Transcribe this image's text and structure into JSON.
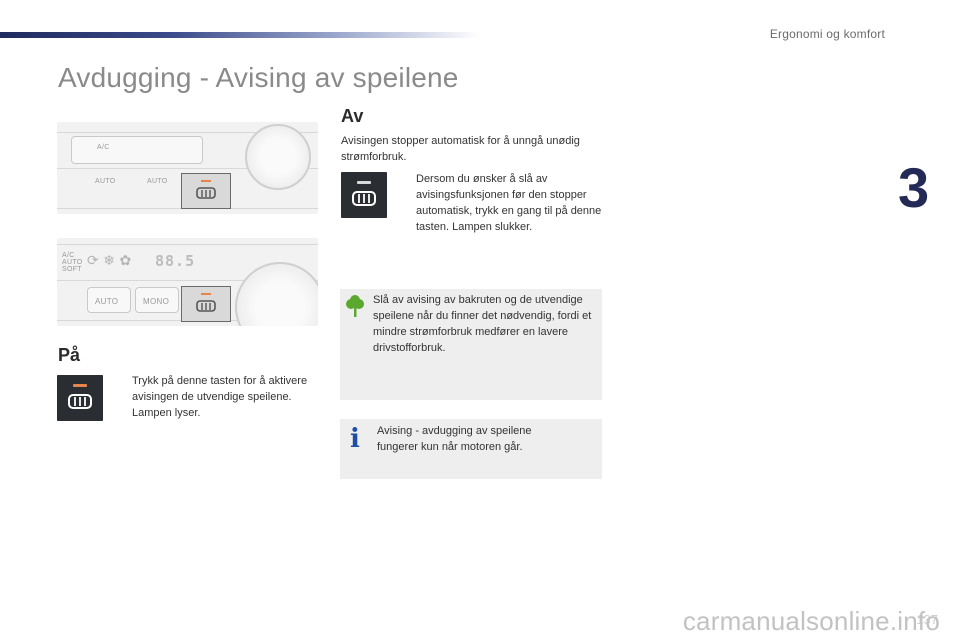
{
  "header": {
    "section_title": "Ergonomi og komfort",
    "chapter_number": "3"
  },
  "page": {
    "title": "Avdugging - Avising av speilene",
    "page_number": "137"
  },
  "illustration_top": {
    "labels": [
      "A/C",
      "AUTO",
      "AUTO"
    ],
    "highlighted_button_icon": "mirror-defrost-icon"
  },
  "illustration_bottom": {
    "labels": [
      "AUTO",
      "MONO",
      "A/C",
      "AUTO",
      "SOFT"
    ],
    "display_readout": "88.5",
    "highlighted_button_icon": "mirror-defrost-icon"
  },
  "section_on": {
    "heading": "På",
    "bullet_symbol": "",
    "text": "Trykk på denne tasten for å aktivere avisingen de utvendige speilene. Lampen lyser.",
    "lamp_color": "#e8834a"
  },
  "section_off": {
    "heading": "Av",
    "intro": "Avisingen stopper automatisk for å unngå unødig strømforbruk.",
    "bullet_symbol": "",
    "text": "Dersom du ønsker å slå av avisingsfunksjonen før den stopper automatisk, trykk en gang til på denne tasten. Lampen slukker.",
    "lamp_color": "#d9d9d9"
  },
  "eco_note": {
    "icon": "tree-icon",
    "icon_color": "#5aa82e",
    "text": "Slå av avising av bakruten og de utvendige speilene når du finner det nødvendig, fordi et mindre strømforbruk medfører en lavere drivstofforbruk."
  },
  "info_note": {
    "icon": "info-icon",
    "icon_symbol": "i",
    "icon_color": "#1d4fa8",
    "text": "Avising - avdugging av speilene fungerer kun når motoren går."
  },
  "watermark": "carmanualsonline.info"
}
